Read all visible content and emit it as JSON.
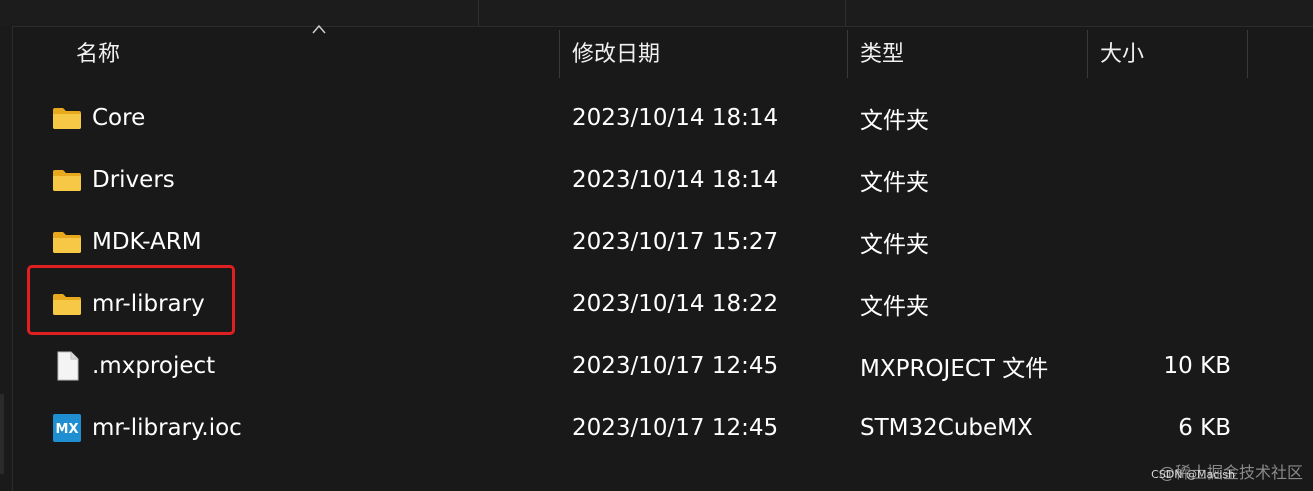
{
  "columns": {
    "name": "名称",
    "modified": "修改日期",
    "type": "类型",
    "size": "大小"
  },
  "files": [
    {
      "name": "Core",
      "modified": "2023/10/14 18:14",
      "type": "文件夹",
      "size": "",
      "icon": "folder-icon"
    },
    {
      "name": "Drivers",
      "modified": "2023/10/14 18:14",
      "type": "文件夹",
      "size": "",
      "icon": "folder-icon"
    },
    {
      "name": "MDK-ARM",
      "modified": "2023/10/17 15:27",
      "type": "文件夹",
      "size": "",
      "icon": "folder-icon"
    },
    {
      "name": "mr-library",
      "modified": "2023/10/14 18:22",
      "type": "文件夹",
      "size": "",
      "icon": "folder-icon"
    },
    {
      "name": ".mxproject",
      "modified": "2023/10/17 12:45",
      "type": "MXPROJECT 文件",
      "size": "10 KB",
      "icon": "file-icon"
    },
    {
      "name": "mr-library.ioc",
      "modified": "2023/10/17 12:45",
      "type": "STM32CubeMX",
      "size": "6 KB",
      "icon": "mx-icon"
    }
  ],
  "mx_icon_text": "MX",
  "watermark": "@稀土掘金技术社区",
  "watermark_small": "CSDN @Macish",
  "colors": {
    "background": "#191919",
    "folder": "#f5c443",
    "highlight": "#e02020",
    "mx_icon": "#1f8fd1"
  }
}
